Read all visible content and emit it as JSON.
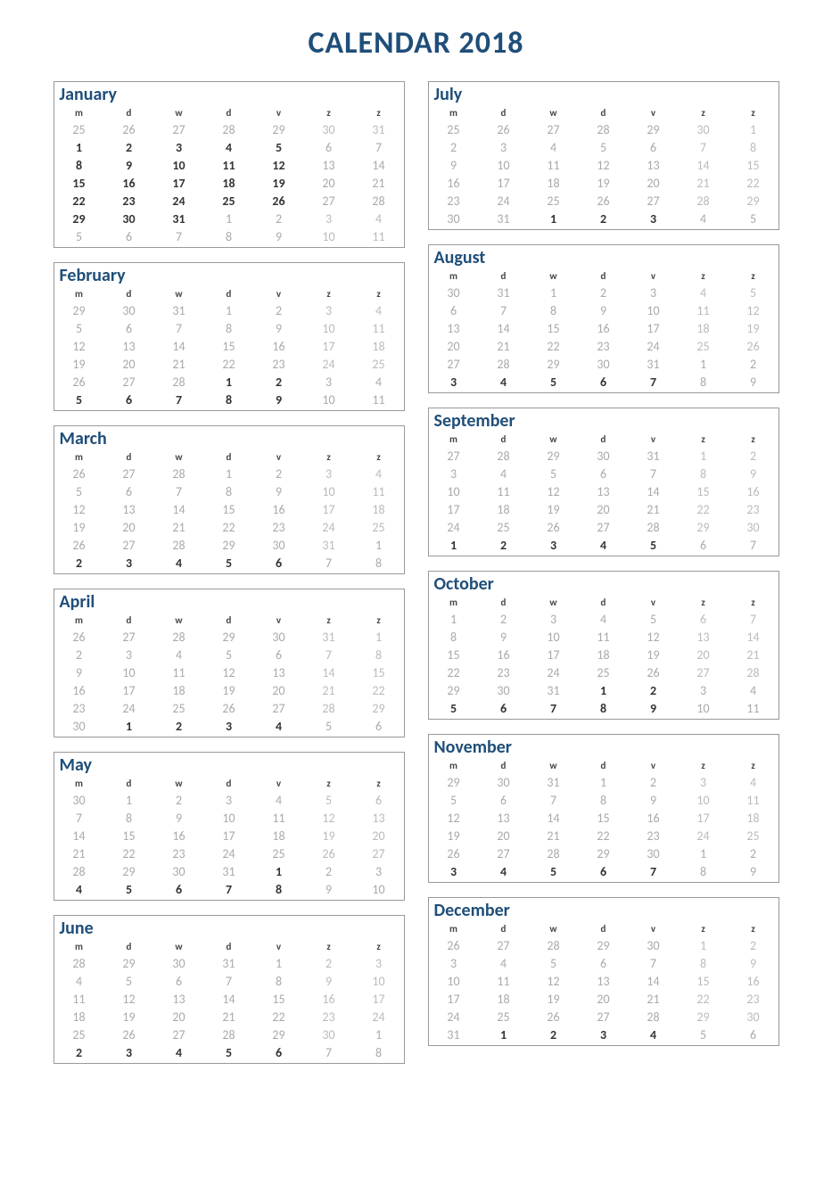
{
  "title": "CALENDAR 2018",
  "day_headers": [
    "m",
    "d",
    "w",
    "d",
    "v",
    "z",
    "z"
  ],
  "months": [
    {
      "name": "January",
      "weeks": [
        [
          25,
          26,
          27,
          28,
          29,
          30,
          31
        ],
        [
          1,
          2,
          3,
          4,
          5,
          6,
          7
        ],
        [
          8,
          9,
          10,
          11,
          12,
          13,
          14
        ],
        [
          15,
          16,
          17,
          18,
          19,
          20,
          21
        ],
        [
          22,
          23,
          24,
          25,
          26,
          27,
          28
        ],
        [
          29,
          30,
          31,
          1,
          2,
          3,
          4
        ],
        [
          5,
          6,
          7,
          8,
          9,
          10,
          11
        ]
      ],
      "start": 1,
      "end": 31
    },
    {
      "name": "February",
      "weeks": [
        [
          29,
          30,
          31,
          1,
          2,
          3,
          4
        ],
        [
          5,
          6,
          7,
          8,
          9,
          10,
          11
        ],
        [
          12,
          13,
          14,
          15,
          16,
          17,
          18
        ],
        [
          19,
          20,
          21,
          22,
          23,
          24,
          25
        ],
        [
          26,
          27,
          28,
          1,
          2,
          3,
          4
        ],
        [
          5,
          6,
          7,
          8,
          9,
          10,
          11
        ]
      ],
      "start": 1,
      "end": 28
    },
    {
      "name": "March",
      "weeks": [
        [
          26,
          27,
          28,
          1,
          2,
          3,
          4
        ],
        [
          5,
          6,
          7,
          8,
          9,
          10,
          11
        ],
        [
          12,
          13,
          14,
          15,
          16,
          17,
          18
        ],
        [
          19,
          20,
          21,
          22,
          23,
          24,
          25
        ],
        [
          26,
          27,
          28,
          29,
          30,
          31,
          1
        ],
        [
          2,
          3,
          4,
          5,
          6,
          7,
          8
        ]
      ],
      "start": 1,
      "end": 31
    },
    {
      "name": "April",
      "weeks": [
        [
          26,
          27,
          28,
          29,
          30,
          31,
          1
        ],
        [
          2,
          3,
          4,
          5,
          6,
          7,
          8
        ],
        [
          9,
          10,
          11,
          12,
          13,
          14,
          15
        ],
        [
          16,
          17,
          18,
          19,
          20,
          21,
          22
        ],
        [
          23,
          24,
          25,
          26,
          27,
          28,
          29
        ],
        [
          30,
          1,
          2,
          3,
          4,
          5,
          6
        ]
      ],
      "start": 1,
      "end": 30
    },
    {
      "name": "May",
      "weeks": [
        [
          30,
          1,
          2,
          3,
          4,
          5,
          6
        ],
        [
          7,
          8,
          9,
          10,
          11,
          12,
          13
        ],
        [
          14,
          15,
          16,
          17,
          18,
          19,
          20
        ],
        [
          21,
          22,
          23,
          24,
          25,
          26,
          27
        ],
        [
          28,
          29,
          30,
          31,
          1,
          2,
          3
        ],
        [
          4,
          5,
          6,
          7,
          8,
          9,
          10
        ]
      ],
      "start": 1,
      "end": 31
    },
    {
      "name": "June",
      "weeks": [
        [
          28,
          29,
          30,
          31,
          1,
          2,
          3
        ],
        [
          4,
          5,
          6,
          7,
          8,
          9,
          10
        ],
        [
          11,
          12,
          13,
          14,
          15,
          16,
          17
        ],
        [
          18,
          19,
          20,
          21,
          22,
          23,
          24
        ],
        [
          25,
          26,
          27,
          28,
          29,
          30,
          1
        ],
        [
          2,
          3,
          4,
          5,
          6,
          7,
          8
        ]
      ],
      "start": 1,
      "end": 30
    },
    {
      "name": "July",
      "weeks": [
        [
          25,
          26,
          27,
          28,
          29,
          30,
          1
        ],
        [
          2,
          3,
          4,
          5,
          6,
          7,
          8
        ],
        [
          9,
          10,
          11,
          12,
          13,
          14,
          15
        ],
        [
          16,
          17,
          18,
          19,
          20,
          21,
          22
        ],
        [
          23,
          24,
          25,
          26,
          27,
          28,
          29
        ],
        [
          30,
          31,
          1,
          2,
          3,
          4,
          5
        ]
      ],
      "start": 1,
      "end": 31
    },
    {
      "name": "August",
      "weeks": [
        [
          30,
          31,
          1,
          2,
          3,
          4,
          5
        ],
        [
          6,
          7,
          8,
          9,
          10,
          11,
          12
        ],
        [
          13,
          14,
          15,
          16,
          17,
          18,
          19
        ],
        [
          20,
          21,
          22,
          23,
          24,
          25,
          26
        ],
        [
          27,
          28,
          29,
          30,
          31,
          1,
          2
        ],
        [
          3,
          4,
          5,
          6,
          7,
          8,
          9
        ]
      ],
      "start": 1,
      "end": 31
    },
    {
      "name": "September",
      "weeks": [
        [
          27,
          28,
          29,
          30,
          31,
          1,
          2
        ],
        [
          3,
          4,
          5,
          6,
          7,
          8,
          9
        ],
        [
          10,
          11,
          12,
          13,
          14,
          15,
          16
        ],
        [
          17,
          18,
          19,
          20,
          21,
          22,
          23
        ],
        [
          24,
          25,
          26,
          27,
          28,
          29,
          30
        ],
        [
          1,
          2,
          3,
          4,
          5,
          6,
          7
        ]
      ],
      "start": 1,
      "end": 30
    },
    {
      "name": "October",
      "weeks": [
        [
          1,
          2,
          3,
          4,
          5,
          6,
          7
        ],
        [
          8,
          9,
          10,
          11,
          12,
          13,
          14
        ],
        [
          15,
          16,
          17,
          18,
          19,
          20,
          21
        ],
        [
          22,
          23,
          24,
          25,
          26,
          27,
          28
        ],
        [
          29,
          30,
          31,
          1,
          2,
          3,
          4
        ],
        [
          5,
          6,
          7,
          8,
          9,
          10,
          11
        ]
      ],
      "start": 1,
      "end": 31
    },
    {
      "name": "November",
      "weeks": [
        [
          29,
          30,
          31,
          1,
          2,
          3,
          4
        ],
        [
          5,
          6,
          7,
          8,
          9,
          10,
          11
        ],
        [
          12,
          13,
          14,
          15,
          16,
          17,
          18
        ],
        [
          19,
          20,
          21,
          22,
          23,
          24,
          25
        ],
        [
          26,
          27,
          28,
          29,
          30,
          1,
          2
        ],
        [
          3,
          4,
          5,
          6,
          7,
          8,
          9
        ]
      ],
      "start": 1,
      "end": 30
    },
    {
      "name": "December",
      "weeks": [
        [
          26,
          27,
          28,
          29,
          30,
          1,
          2
        ],
        [
          3,
          4,
          5,
          6,
          7,
          8,
          9
        ],
        [
          10,
          11,
          12,
          13,
          14,
          15,
          16
        ],
        [
          17,
          18,
          19,
          20,
          21,
          22,
          23
        ],
        [
          24,
          25,
          26,
          27,
          28,
          29,
          30
        ],
        [
          31,
          1,
          2,
          3,
          4,
          5,
          6
        ]
      ],
      "start": 1,
      "end": 31
    }
  ],
  "first_row_is_prev": true
}
